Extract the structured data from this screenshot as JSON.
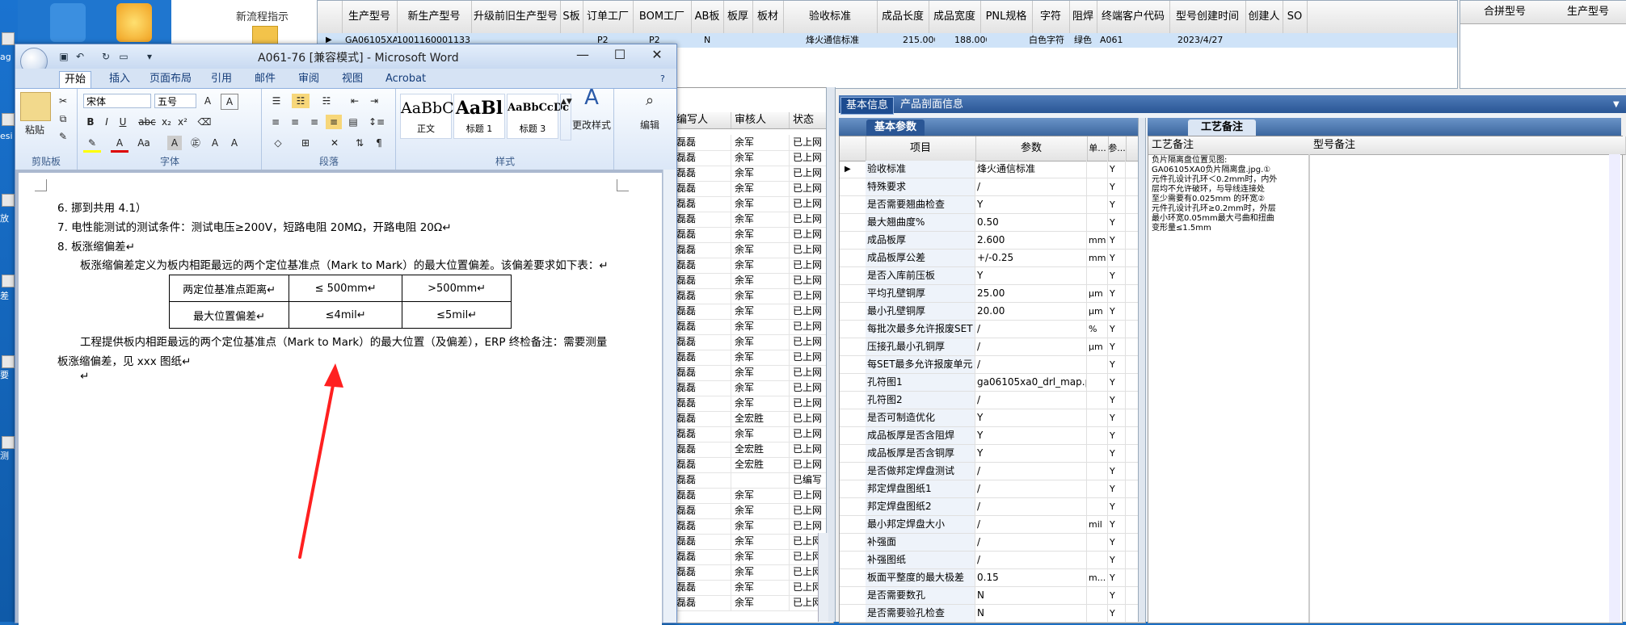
{
  "desktop": {
    "left_labels": [
      "ag",
      "esi",
      "放",
      "差",
      "要",
      "测"
    ]
  },
  "erp": {
    "left_panel_label": "新流程指示",
    "top_grid": {
      "headers": [
        "生产型号",
        "新生产型号",
        "升级前旧生产型号",
        "S板",
        "订单工厂",
        "BOM工厂",
        "AB板",
        "板厚",
        "板材",
        "验收标准",
        "成品长度",
        "成品宽度",
        "PNL规格",
        "字符",
        "阻焊",
        "终端客户代码",
        "型号创建时间",
        "创建人",
        "SO"
      ],
      "row": [
        "GA06105XA0",
        "10011600011331",
        "",
        "",
        "P2",
        "P2",
        "N",
        "",
        "",
        "烽火通信标准",
        "215.000",
        "188.000",
        "",
        "白色字符",
        "绿色",
        "A061",
        "2023/4/27",
        "",
        ""
      ]
    },
    "right_grid_headers": [
      "合拼型号",
      "生产型号"
    ],
    "mid_list": {
      "headers": [
        "编写人",
        "审核人",
        "状态"
      ],
      "rows": [
        [
          "磊磊",
          "余军",
          "已上网"
        ],
        [
          "磊磊",
          "余军",
          "已上网"
        ],
        [
          "磊磊",
          "余军",
          "已上网"
        ],
        [
          "磊磊",
          "余军",
          "已上网"
        ],
        [
          "磊磊",
          "余军",
          "已上网"
        ],
        [
          "磊磊",
          "余军",
          "已上网"
        ],
        [
          "磊磊",
          "余军",
          "已上网"
        ],
        [
          "磊磊",
          "余军",
          "已上网"
        ],
        [
          "磊磊",
          "余军",
          "已上网"
        ],
        [
          "磊磊",
          "余军",
          "已上网"
        ],
        [
          "磊磊",
          "余军",
          "已上网"
        ],
        [
          "磊磊",
          "余军",
          "已上网"
        ],
        [
          "磊磊",
          "余军",
          "已上网"
        ],
        [
          "磊磊",
          "余军",
          "已上网"
        ],
        [
          "磊磊",
          "余军",
          "已上网"
        ],
        [
          "磊磊",
          "余军",
          "已上网"
        ],
        [
          "磊磊",
          "余军",
          "已上网"
        ],
        [
          "磊磊",
          "余军",
          "已上网"
        ],
        [
          "磊磊",
          "全宏胜",
          "已上网"
        ],
        [
          "磊磊",
          "余军",
          "已上网"
        ],
        [
          "磊磊",
          "全宏胜",
          "已上网"
        ],
        [
          "磊磊",
          "全宏胜",
          "已上网"
        ],
        [
          "磊磊",
          "",
          "已编写"
        ],
        [
          "磊磊",
          "余军",
          "已上网"
        ],
        [
          "磊磊",
          "余军",
          "已上网"
        ],
        [
          "磊磊",
          "余军",
          "已上网"
        ],
        [
          "磊磊",
          "余军",
          "已上网"
        ],
        [
          "磊磊",
          "余军",
          "已上网"
        ],
        [
          "磊磊",
          "余军",
          "已上网"
        ],
        [
          "磊磊",
          "余军",
          "已上网"
        ],
        [
          "磊磊",
          "余军",
          "已上网"
        ]
      ]
    },
    "info_tabs": [
      "基本信息",
      "产品剖面信息"
    ],
    "param_tab": "基本参数",
    "param_headers": [
      "项目",
      "参数",
      "单...",
      "参..."
    ],
    "params": [
      [
        "验收标准",
        "烽火通信标准",
        "",
        "Y"
      ],
      [
        "特殊要求",
        "/",
        "",
        "Y"
      ],
      [
        "是否需要翘曲检查",
        "Y",
        "",
        "Y"
      ],
      [
        "最大翘曲度%",
        "0.50",
        "",
        "Y"
      ],
      [
        "成品板厚",
        "2.600",
        "mm",
        "Y"
      ],
      [
        "成品板厚公差",
        "+/-0.25",
        "mm",
        "Y"
      ],
      [
        "是否入库前压板",
        "Y",
        "",
        "Y"
      ],
      [
        "平均孔壁铜厚",
        "25.00",
        "μm",
        "Y"
      ],
      [
        "最小孔壁铜厚",
        "20.00",
        "μm",
        "Y"
      ],
      [
        "每批次最多允许报废SET",
        "/",
        "%",
        "Y"
      ],
      [
        "压接孔最小孔铜厚",
        "/",
        "μm",
        "Y"
      ],
      [
        "每SET最多允许报废单元",
        "/",
        "",
        "Y"
      ],
      [
        "孔符图1",
        "ga06105xa0_drl_map.pdf",
        "",
        "Y"
      ],
      [
        "孔符图2",
        "/",
        "",
        "Y"
      ],
      [
        "是否可制造优化",
        "Y",
        "",
        "Y"
      ],
      [
        "成品板厚是否含阻焊",
        "Y",
        "",
        "Y"
      ],
      [
        "成品板厚是否含铜厚",
        "Y",
        "",
        "Y"
      ],
      [
        "是否做邦定焊盘测试",
        "/",
        "",
        "Y"
      ],
      [
        "邦定焊盘图纸1",
        "/",
        "",
        "Y"
      ],
      [
        "邦定焊盘图纸2",
        "/",
        "",
        "Y"
      ],
      [
        "最小邦定焊盘大小",
        "/",
        "mil",
        "Y"
      ],
      [
        "补强面",
        "/",
        "",
        "Y"
      ],
      [
        "补强图纸",
        "/",
        "",
        "Y"
      ],
      [
        "板面平整度的最大极差",
        "0.15",
        "m...",
        "Y"
      ],
      [
        "是否需要数孔",
        "N",
        "",
        "Y"
      ],
      [
        "是否需要验孔检查",
        "N",
        "",
        "Y"
      ]
    ],
    "remark_tab": "工艺备注",
    "remark_headers": [
      "工艺备注",
      "型号备注"
    ],
    "remark_text": "负片隔离盘位置见图:\nGA06105XA0负片隔离盘.jpg.①\n元件孔设计孔环＜0.2mm时，内外\n层均不允许破环，与导线连接处\n至少需要有0.025mm 的环宽②\n元件孔设计孔环≥0.2mm时，外层\n最小环宽0.05mm最大弓曲和扭曲\n变形量≤1.5mm"
  },
  "word": {
    "title": "A061-76 [兼容模式] - Microsoft Word",
    "tabs": [
      "开始",
      "插入",
      "页面布局",
      "引用",
      "邮件",
      "审阅",
      "视图",
      "Acrobat"
    ],
    "groups": [
      "剪贴板",
      "字体",
      "段落",
      "样式"
    ],
    "paste_label": "粘贴",
    "font_name": "宋体",
    "font_size": "五号",
    "styles": [
      {
        "preview": "AaBbC",
        "name": "正文"
      },
      {
        "preview": "AaBl",
        "name": "标题 1"
      },
      {
        "preview": "AaBbCcDc",
        "name": "标题 3"
      }
    ],
    "change_styles": "更改样式",
    "edit_label": "编辑",
    "doc": {
      "line6": "6.   挪到共用 4.1）",
      "line7": "7.   电性能测试的测试条件：测试电压≥200V，短路电阻 20MΩ，开路电阻 20Ω↵",
      "line8": "8.   板涨缩偏差↵",
      "line9": "板涨缩偏差定义为板内相距最远的两个定位基准点（Mark to Mark）的最大位置偏差。该偏差要求如下表：↵",
      "table": [
        [
          "两定位基准点距离↵",
          "≤ 500mm↵",
          ">500mm↵"
        ],
        [
          "最大位置偏差↵",
          "≤4mil↵",
          "≤5mil↵"
        ]
      ],
      "para1": "工程提供板内相距最远的两个定位基准点（Mark to Mark）的最大位置（及偏差），ERP 终检备注：需要测量",
      "para2": "板涨缩偏差，见 xxx 图纸↵",
      "para3": "↵"
    }
  },
  "colors": {
    "annotation_arrow": "#ff2020",
    "desktop": "#1b6fc4",
    "word_frame": "#dce7f5"
  }
}
